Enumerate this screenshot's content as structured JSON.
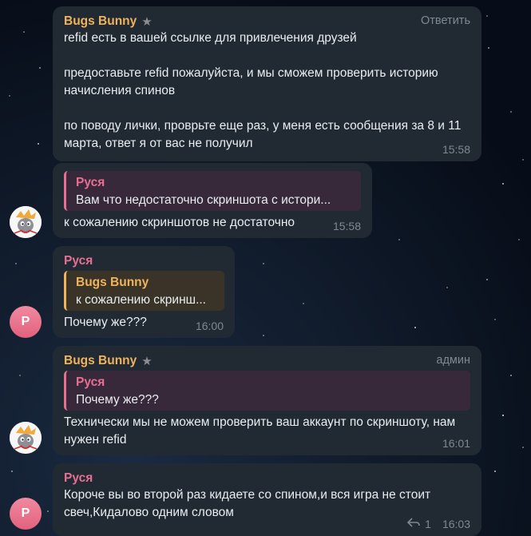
{
  "colors": {
    "bubble_bg": "#212a33",
    "bugs_name": "#f0b35b",
    "rusya_name": "#e86f93",
    "muted": "#7d8893",
    "text": "#e9edf0"
  },
  "messages": [
    {
      "sender": "Bugs Bunny",
      "badge_icon": "star-icon",
      "top_right": "Ответить",
      "text": "refid есть в вашей ссылке для привлечения друзей\n\nпредоставьте refid пожалуйста, и мы сможем проверить историю начисления спинов\n\nпо поводу лички, проврьте еще раз, у меня есть сообщения за 8 и 11 марта, ответ я от вас не получил",
      "time": "15:58"
    },
    {
      "quote_name": "Руся",
      "quote_text": "Вам что недостаточно скриншота с истори...",
      "text": "к сожалению скриншотов не достаточно",
      "time": "15:58"
    },
    {
      "sender": "Руся",
      "avatar_letter": "Р",
      "quote_name": "Bugs Bunny",
      "quote_text": "к сожалению скринш...",
      "text": "Почему же???",
      "time": "16:00"
    },
    {
      "sender": "Bugs Bunny",
      "badge_icon": "star-icon",
      "top_right": "админ",
      "quote_name": "Руся",
      "quote_text": "Почему же???",
      "text": "Технически мы не можем проверить ваш аккаунт по скриншоту, нам нужен refid",
      "time": "16:01"
    },
    {
      "sender": "Руся",
      "avatar_letter": "Р",
      "text": "Короче вы во второй раз кидаете со спином,и вся игра не стоит свеч,Кидалово одним словом",
      "reply_count": "1",
      "time": "16:03"
    }
  ]
}
